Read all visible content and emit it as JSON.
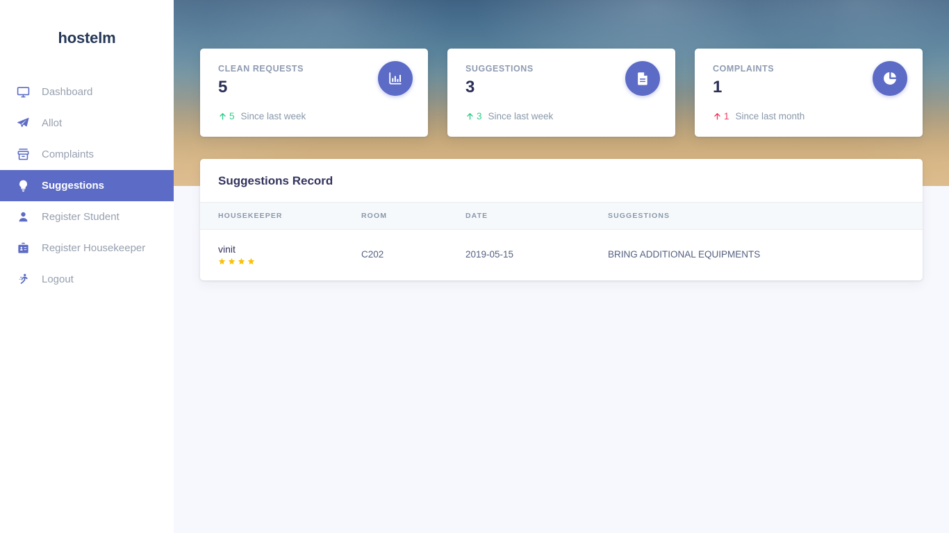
{
  "brand": {
    "name": "hostelm"
  },
  "sidebar": {
    "items": [
      {
        "label": "Dashboard",
        "icon": "monitor-icon",
        "active": false
      },
      {
        "label": "Allot",
        "icon": "paper-plane-icon",
        "active": false
      },
      {
        "label": "Complaints",
        "icon": "archive-box-icon",
        "active": false
      },
      {
        "label": "Suggestions",
        "icon": "lightbulb-icon",
        "active": true
      },
      {
        "label": "Register Student",
        "icon": "user-icon",
        "active": false
      },
      {
        "label": "Register Housekeeper",
        "icon": "id-card-icon",
        "active": false
      },
      {
        "label": "Logout",
        "icon": "running-man-icon",
        "active": false
      }
    ]
  },
  "cards": [
    {
      "title": "CLEAN REQUESTS",
      "value": "5",
      "icon": "bar-chart-icon",
      "trend_direction": "up",
      "trend_value": "5",
      "trend_text": "Since last week",
      "trend_color": "#2dce89"
    },
    {
      "title": "SUGGESTIONS",
      "value": "3",
      "icon": "document-icon",
      "trend_direction": "up",
      "trend_value": "3",
      "trend_text": "Since last week",
      "trend_color": "#2dce89"
    },
    {
      "title": "COMPLAINTS",
      "value": "1",
      "icon": "pie-chart-icon",
      "trend_direction": "up",
      "trend_value": "1",
      "trend_text": "Since last month",
      "trend_color": "#f5365c"
    }
  ],
  "panel": {
    "title": "Suggestions Record",
    "columns": [
      "HOUSEKEEPER",
      "ROOM",
      "DATE",
      "SUGGESTIONS"
    ],
    "rows": [
      {
        "housekeeper": "vinit",
        "rating": 4,
        "rating_max": 4,
        "room": "C202",
        "date": "2019-05-15",
        "suggestion": "BRING ADDITIONAL EQUIPMENTS"
      }
    ]
  },
  "colors": {
    "accent": "#5c6bc5",
    "positive": "#2dce89",
    "negative": "#f5365c",
    "star": "#fac10c",
    "page_bg": "#f6f8fd",
    "text_dark": "#32325d",
    "text_muted": "#8898aa"
  }
}
